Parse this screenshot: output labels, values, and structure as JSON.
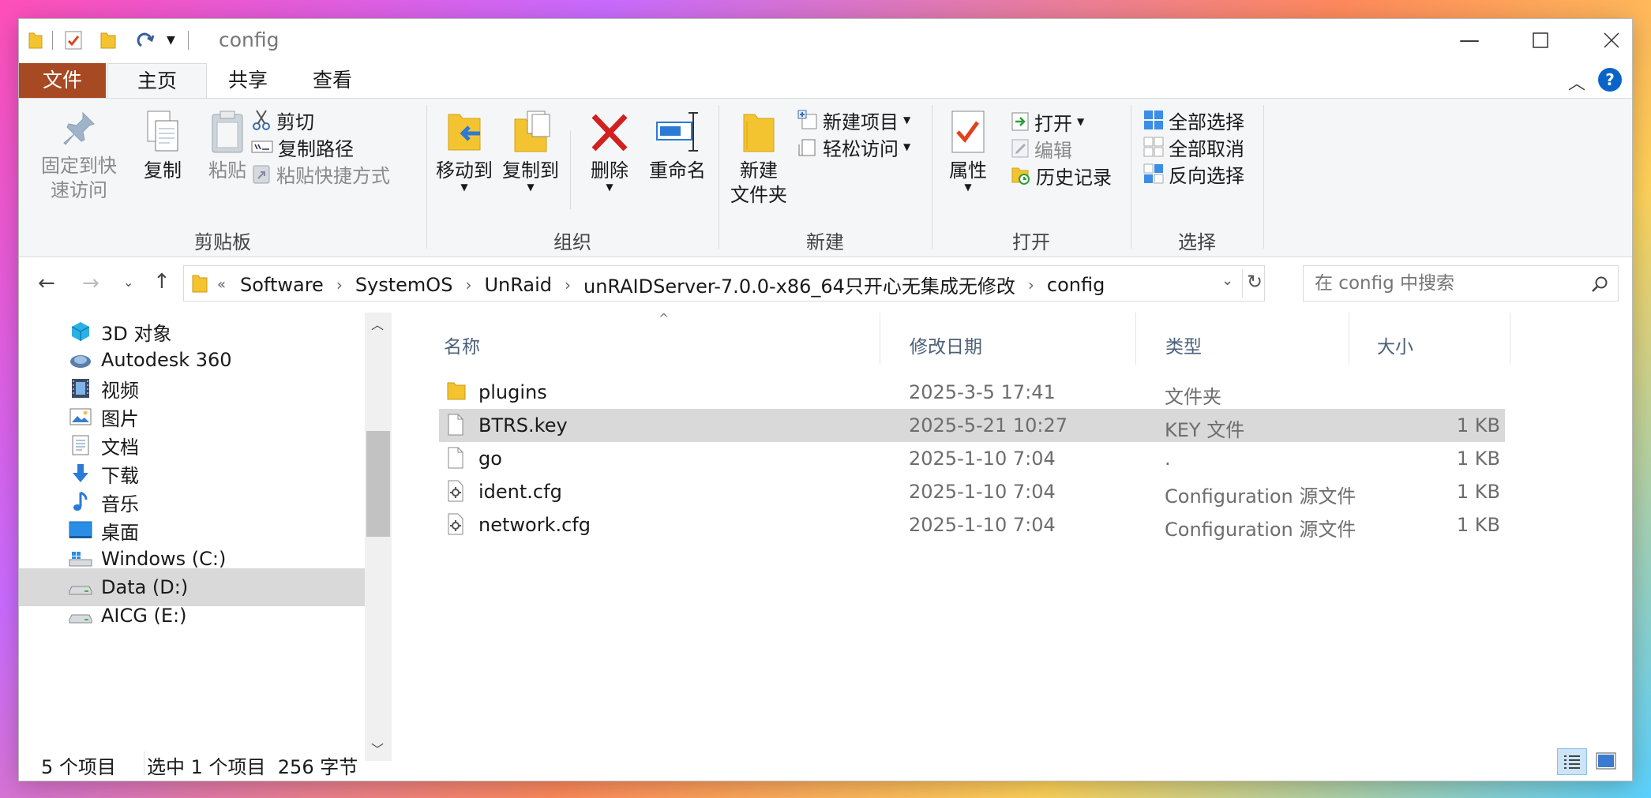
{
  "window": {
    "title": "config"
  },
  "ribbon_tabs": {
    "file": "文件",
    "home": "主页",
    "share": "共享",
    "view": "查看"
  },
  "clipboard": {
    "pin": "固定到快\n速访问",
    "pin_l1": "固定到快",
    "pin_l2": "速访问",
    "copy": "复制",
    "paste": "粘贴",
    "cut": "剪切",
    "copy_path": "复制路径",
    "paste_shortcut": "粘贴快捷方式",
    "group": "剪贴板"
  },
  "organize": {
    "move_to": "移动到",
    "copy_to": "复制到",
    "delete": "删除",
    "rename": "重命名",
    "group": "组织"
  },
  "new": {
    "new_folder_l1": "新建",
    "new_folder_l2": "文件夹",
    "new_item": "新建项目",
    "easy_access": "轻松访问",
    "group": "新建"
  },
  "open": {
    "properties": "属性",
    "open": "打开",
    "edit": "编辑",
    "history": "历史记录",
    "group": "打开"
  },
  "select": {
    "select_all": "全部选择",
    "select_none": "全部取消",
    "invert": "反向选择",
    "group": "选择"
  },
  "address": {
    "overflow": "«",
    "crumbs": [
      "Software",
      "SystemOS",
      "UnRaid",
      "unRAIDServer-7.0.0-x86_64只开心无集成无修改",
      "config"
    ]
  },
  "search": {
    "placeholder": "在 config 中搜索"
  },
  "nav_pane": {
    "items": [
      {
        "label": "3D 对象",
        "icon": "3d-objects-icon"
      },
      {
        "label": "Autodesk 360",
        "icon": "autodesk-icon"
      },
      {
        "label": "视频",
        "icon": "video-icon"
      },
      {
        "label": "图片",
        "icon": "pictures-icon"
      },
      {
        "label": "文档",
        "icon": "documents-icon"
      },
      {
        "label": "下载",
        "icon": "downloads-icon"
      },
      {
        "label": "音乐",
        "icon": "music-icon"
      },
      {
        "label": "桌面",
        "icon": "desktop-icon"
      },
      {
        "label": "Windows (C:)",
        "icon": "windows-drive-icon"
      },
      {
        "label": "Data (D:)",
        "icon": "drive-icon",
        "selected": true
      },
      {
        "label": "AICG (E:)",
        "icon": "drive-icon"
      }
    ]
  },
  "columns": {
    "name": "名称",
    "date": "修改日期",
    "type": "类型",
    "size": "大小"
  },
  "files": [
    {
      "name": "plugins",
      "date": "2025-3-5 17:41",
      "type": "文件夹",
      "size": "",
      "icon": "folder-icon"
    },
    {
      "name": "BTRS.key",
      "date": "2025-5-21 10:27",
      "type": "KEY 文件",
      "size": "1 KB",
      "icon": "file-icon",
      "selected": true
    },
    {
      "name": "go",
      "date": "2025-1-10 7:04",
      "type": ".",
      "size": "1 KB",
      "icon": "file-icon"
    },
    {
      "name": "ident.cfg",
      "date": "2025-1-10 7:04",
      "type": "Configuration 源文件",
      "size": "1 KB",
      "icon": "config-file-icon"
    },
    {
      "name": "network.cfg",
      "date": "2025-1-10 7:04",
      "type": "Configuration 源文件",
      "size": "1 KB",
      "icon": "config-file-icon"
    }
  ],
  "status": {
    "count": "5 个项目",
    "selection": "选中 1 个项目  256 字节"
  },
  "colors": {
    "file_tab": "#a74a23",
    "accent": "#0a64c8",
    "selection": "#d9d9d9"
  }
}
